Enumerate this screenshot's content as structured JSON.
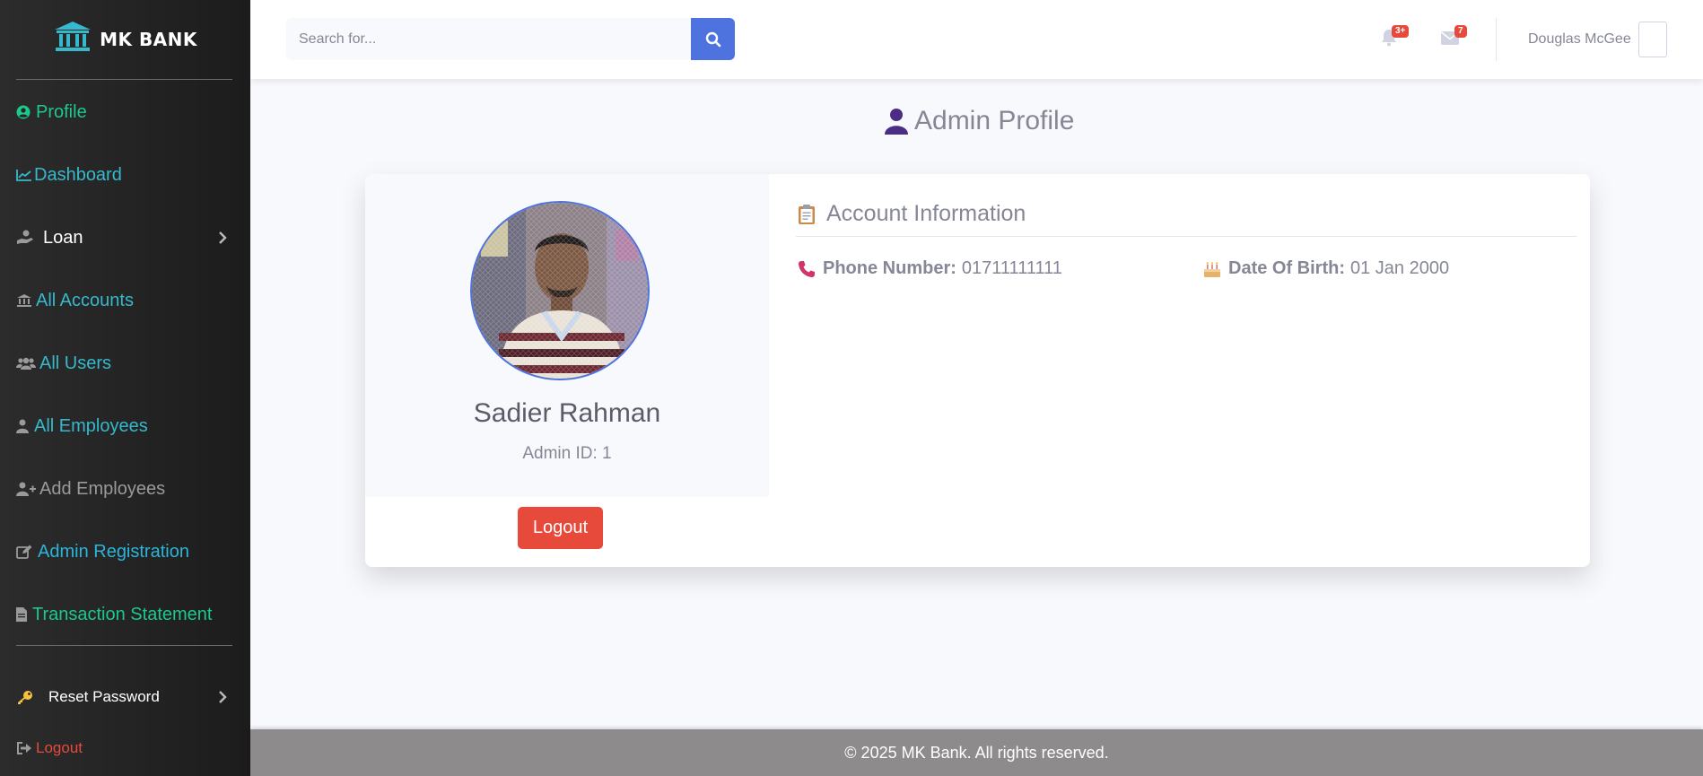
{
  "brand": {
    "name": "MK BANK",
    "icon": "bank-icon"
  },
  "sidebar": {
    "items": [
      {
        "label": "Profile",
        "icon": "user-circle-icon",
        "color": "#1cc88a"
      },
      {
        "label": "Dashboard",
        "icon": "chart-line-icon",
        "color": "#36b9cc"
      },
      {
        "label": "Loan",
        "icon": "hand-holding-icon",
        "color": "#ffffff",
        "has_submenu": true
      },
      {
        "label": "All Accounts",
        "icon": "bank-icon",
        "color": "#36b9cc"
      },
      {
        "label": "All Users",
        "icon": "users-icon",
        "color": "#36b9cc"
      },
      {
        "label": "All Employees",
        "icon": "user-tie-icon",
        "color": "#36b9cc"
      },
      {
        "label": "Add Employees",
        "icon": "user-plus-icon",
        "color": "#9a9a9a"
      },
      {
        "label": "Admin Registration",
        "icon": "edit-icon",
        "color": "#36b9cc"
      },
      {
        "label": "Transaction Statement",
        "icon": "file-icon",
        "color": "#1cc88a"
      }
    ],
    "reset_password": {
      "label": "Reset Password",
      "icon": "key-icon",
      "color": "#f6c23e"
    },
    "logout": {
      "label": "Logout",
      "icon": "sign-out-icon",
      "color": "#e74a3b"
    }
  },
  "topbar": {
    "search_placeholder": "Search for...",
    "alerts_badge": "3+",
    "messages_badge": "7",
    "user_name": "Douglas McGee"
  },
  "main": {
    "page_title": "Admin Profile",
    "profile": {
      "name": "Sadier Rahman",
      "admin_id": "Admin ID: 1",
      "logout_label": "Logout"
    },
    "account": {
      "heading": "Account Information",
      "phone_label": "Phone Number:",
      "phone_value": "01711111111",
      "dob_label": "Date Of Birth:",
      "dob_value": "01 Jan 2000"
    }
  },
  "footer": {
    "text": "© 2025 MK Bank. All rights reserved."
  },
  "colors": {
    "primary": "#4e73df",
    "danger": "#e74a3b",
    "success": "#1cc88a",
    "info": "#36b9cc"
  }
}
